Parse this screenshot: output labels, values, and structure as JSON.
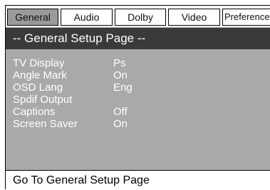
{
  "tabs": [
    {
      "label": "General",
      "active": true
    },
    {
      "label": "Audio",
      "active": false
    },
    {
      "label": "Dolby",
      "active": false
    },
    {
      "label": "Video",
      "active": false
    },
    {
      "label": "Preference",
      "active": false
    }
  ],
  "header": {
    "title": "-- General Setup Page --"
  },
  "settings": [
    {
      "label": "TV Display",
      "value": "Ps"
    },
    {
      "label": "Angle Mark",
      "value": "On"
    },
    {
      "label": "OSD Lang",
      "value": "Eng"
    },
    {
      "label": "Spdif Output",
      "value": ""
    },
    {
      "label": "Captions",
      "value": "Off"
    },
    {
      "label": "Screen Saver",
      "value": "On"
    }
  ],
  "status": {
    "text": "Go To General Setup Page"
  },
  "colors": {
    "panel": "#a9a9a9",
    "header": "#3a3a3a",
    "active_tab": "#9a9a9a"
  }
}
